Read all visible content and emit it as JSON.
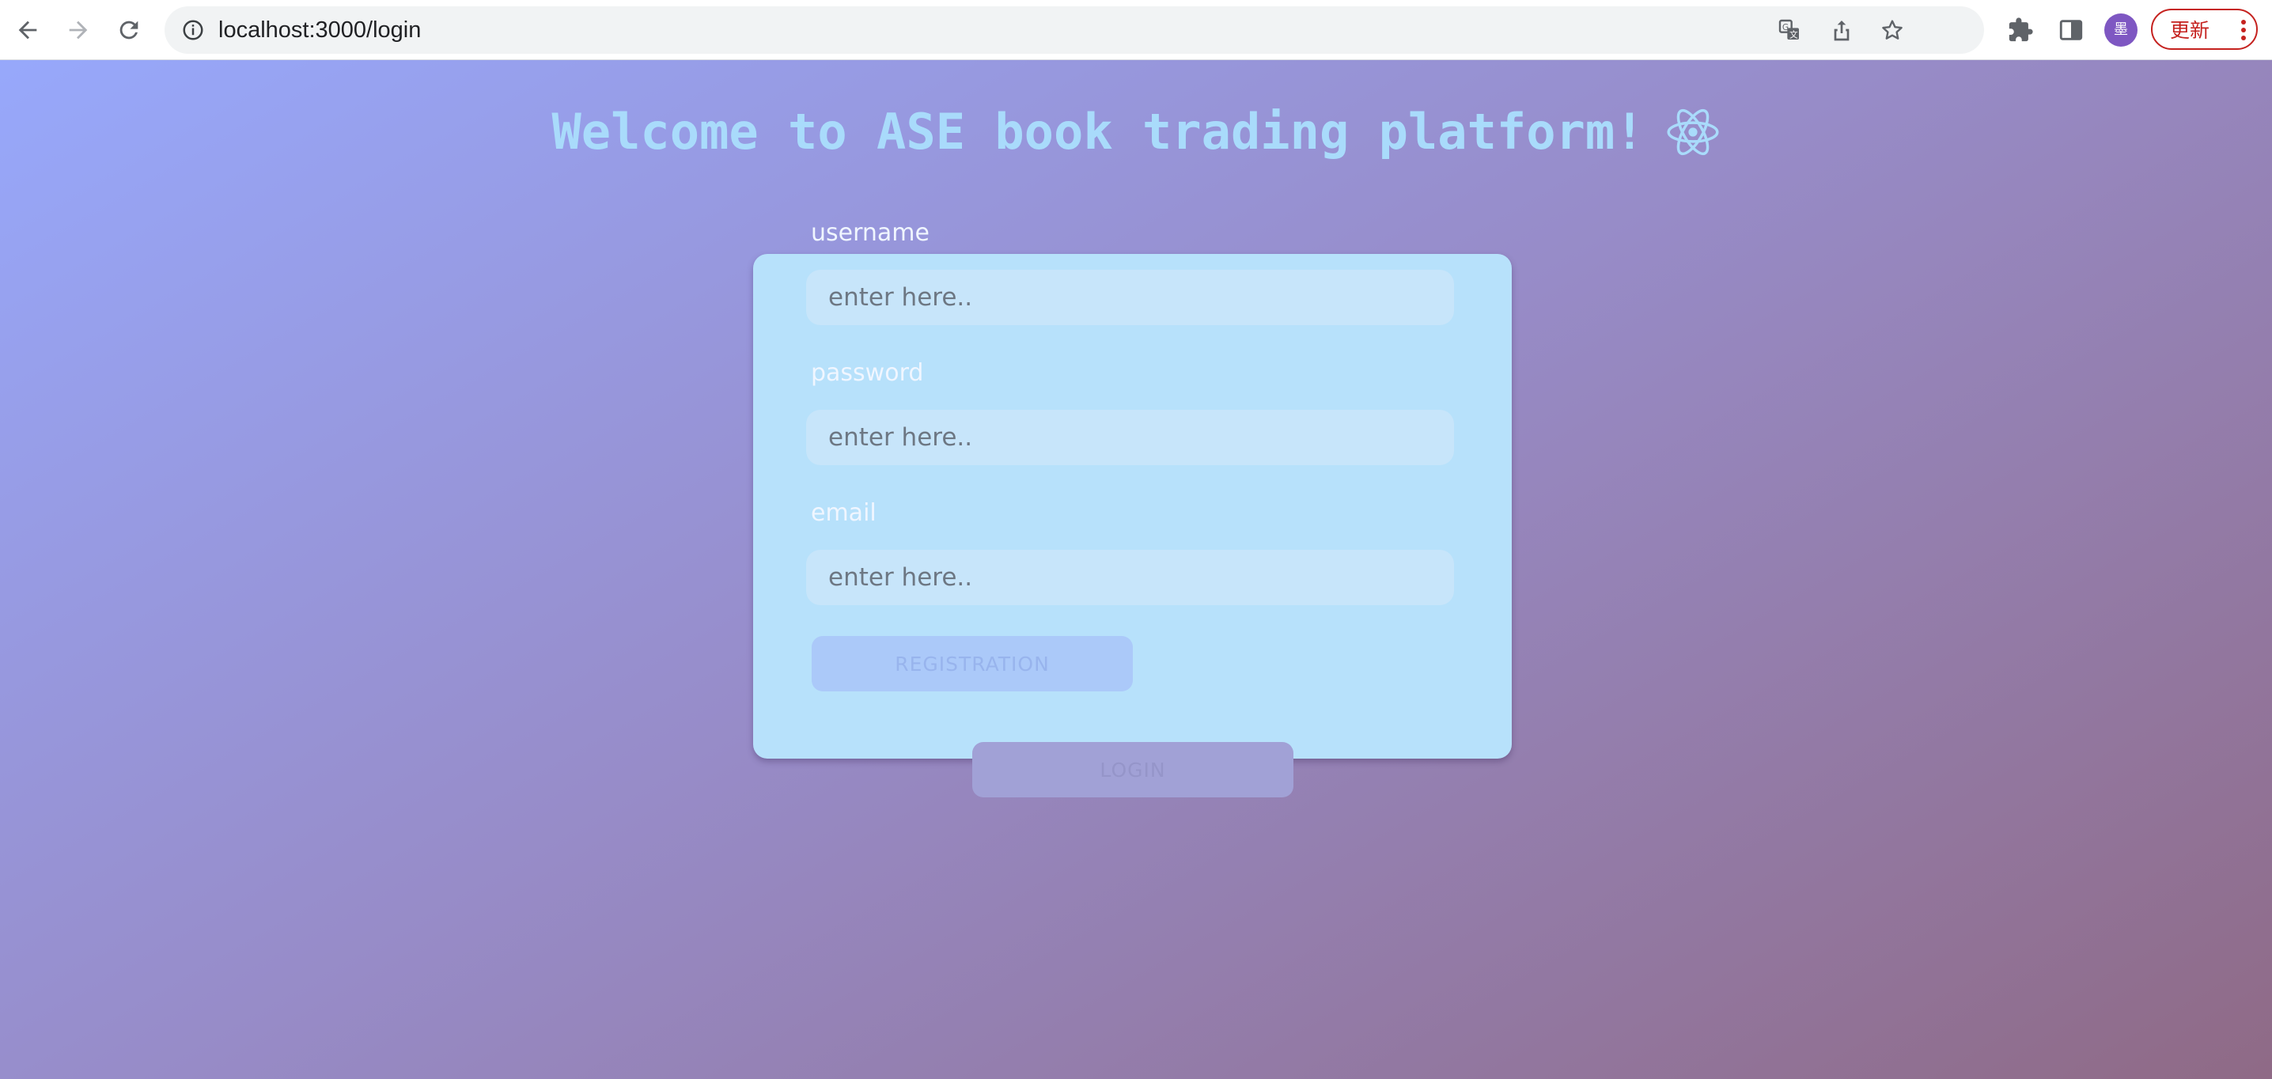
{
  "browser": {
    "url": "localhost:3000/login",
    "update_label": "更新",
    "avatar_text": "墨"
  },
  "page": {
    "title": "Welcome to ASE book trading platform!",
    "colors": {
      "title": "#a9dbfb",
      "card": "#b7e1fb",
      "input": "#c7e5fa",
      "registration_button": "#abc9f9",
      "login_button": "#a1a1d6"
    },
    "form": {
      "username": {
        "label": "username",
        "placeholder": "enter here.."
      },
      "password": {
        "label": "password",
        "placeholder": "enter here.."
      },
      "email": {
        "label": "email",
        "placeholder": "enter here.."
      },
      "registration_label": "REGISTRATION"
    },
    "login_label": "LOGIN"
  },
  "icons": {
    "back": "back-arrow-icon",
    "forward": "forward-arrow-icon",
    "reload": "reload-icon",
    "info": "info-icon",
    "translate": "translate-icon",
    "share": "share-icon",
    "bookmark": "star-icon",
    "extensions": "puzzle-icon",
    "side_panel": "side-panel-icon",
    "title_logo": "react-atom-icon"
  }
}
